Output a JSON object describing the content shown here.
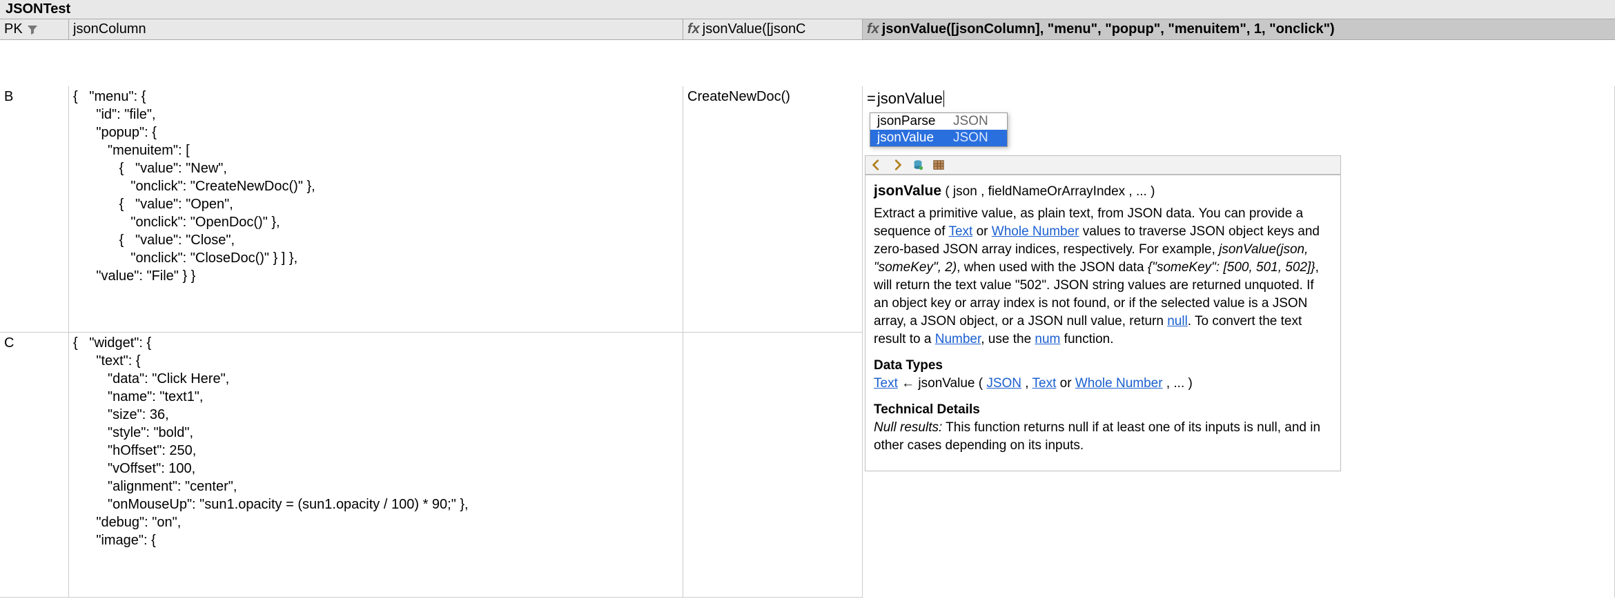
{
  "title": "JSONTest",
  "columns": {
    "pk": "PK",
    "json": "jsonColumn",
    "fx1_label": "jsonValue([jsonC",
    "fx2_label": "jsonValue([jsonColumn], \"menu\", \"popup\", \"menuitem\", 1, \"onclick\")"
  },
  "rows": [
    {
      "pk": "B",
      "json": "{   \"menu\": {\n      \"id\": \"file\",\n      \"popup\": {\n         \"menuitem\": [\n            {   \"value\": \"New\",\n               \"onclick\": \"CreateNewDoc()\" },\n            {   \"value\": \"Open\",\n               \"onclick\": \"OpenDoc()\" },\n            {   \"value\": \"Close\",\n               \"onclick\": \"CloseDoc()\" } ] },\n      \"value\": \"File\" } }",
      "fx1": "CreateNewDoc()"
    },
    {
      "pk": "C",
      "json": "{   \"widget\": {\n      \"text\": {\n         \"data\": \"Click Here\",\n         \"name\": \"text1\",\n         \"size\": 36,\n         \"style\": \"bold\",\n         \"hOffset\": 250,\n         \"vOffset\": 100,\n         \"alignment\": \"center\",\n         \"onMouseUp\": \"sun1.opacity = (sun1.opacity / 100) * 90;\" },\n      \"debug\": \"on\",\n      \"image\": {",
      "fx1": ""
    }
  ],
  "editor": {
    "prefix": "=",
    "text": "jsonValue"
  },
  "autocomplete": [
    {
      "name": "jsonParse",
      "cat": "JSON",
      "selected": false
    },
    {
      "name": "jsonValue",
      "cat": "JSON",
      "selected": true
    }
  ],
  "doc": {
    "fn": "jsonValue",
    "params": "( json ,  fieldNameOrArrayIndex ,  ... )",
    "body_parts": {
      "p1a": "Extract a primitive value, as plain text, from JSON data. You can provide a sequence of ",
      "link_text": "Text",
      "p1b": " or ",
      "link_wn": "Whole Number",
      "p1c": " values to traverse JSON object keys and zero-based JSON array indices, respectively. For example, ",
      "em1": "jsonValue(json, \"someKey\", 2)",
      "p1d": ", when used with the JSON data ",
      "em2": "{\"someKey\": [500, 501, 502]}",
      "p1e": ", will return the text value \"502\". JSON string values are returned unquoted. If an object key or array index is not found, or if the selected value is a JSON array, a JSON object, or a JSON null value, return ",
      "link_null": "null",
      "p1f": ". To convert the text result to a ",
      "link_num": "Number",
      "p1g": ", use the ",
      "link_numfn": "num",
      "p1h": " function."
    },
    "datatypes_h": "Data Types",
    "datatypes": {
      "ret": "Text",
      "arrow": " ← jsonValue ( ",
      "a1": "JSON",
      "sep": " ,  ",
      "a2": "Text",
      "or": " or ",
      "a3": "Whole Number",
      "tail": " ,  ... )"
    },
    "tech_h": "Technical Details",
    "tech": {
      "em": "Null results:",
      "body": " This function returns null if at least one of its inputs is null, and in other cases depending on its inputs."
    }
  }
}
